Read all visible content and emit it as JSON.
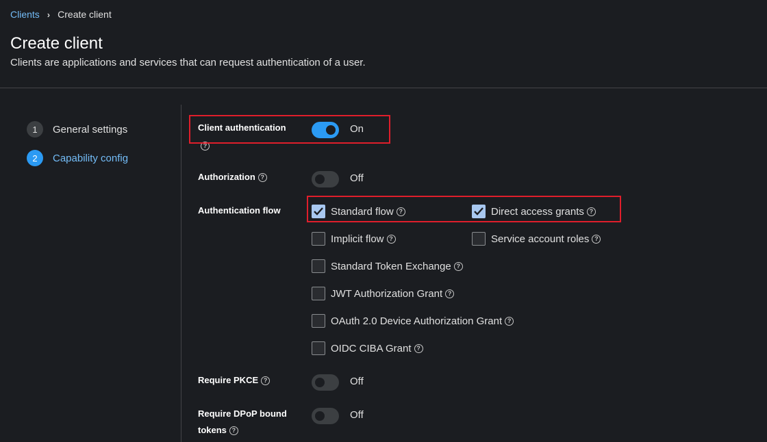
{
  "breadcrumb": {
    "parent": "Clients",
    "current": "Create client"
  },
  "header": {
    "title": "Create client",
    "description": "Clients are applications and services that can request authentication of a user."
  },
  "wizard": {
    "steps": [
      {
        "number": "1",
        "label": "General settings",
        "active": false
      },
      {
        "number": "2",
        "label": "Capability config",
        "active": true
      }
    ]
  },
  "form": {
    "client_authentication": {
      "label": "Client authentication",
      "state": "On"
    },
    "authorization": {
      "label": "Authorization",
      "state": "Off"
    },
    "authentication_flow": {
      "label": "Authentication flow",
      "options": [
        {
          "label": "Standard flow",
          "checked": true
        },
        {
          "label": "Direct access grants",
          "checked": true
        },
        {
          "label": "Implicit flow",
          "checked": false
        },
        {
          "label": "Service account roles",
          "checked": false
        },
        {
          "label": "Standard Token Exchange",
          "checked": false
        },
        {
          "label": "JWT Authorization Grant",
          "checked": false
        },
        {
          "label": "OAuth 2.0 Device Authorization Grant",
          "checked": false
        },
        {
          "label": "OIDC CIBA Grant",
          "checked": false
        }
      ]
    },
    "require_pkce": {
      "label": "Require PKCE",
      "state": "Off"
    },
    "require_dpop": {
      "label_line1": "Require DPoP bound",
      "label_line2": "tokens",
      "state": "Off"
    }
  },
  "colors": {
    "accent": "#2b9af3",
    "link": "#73bcf7",
    "highlight_box": "#e01e2b",
    "background": "#1b1d21"
  },
  "icons": {
    "help": "question-circle-icon",
    "breadcrumb_separator": "chevron-right-icon",
    "check": "check-icon"
  }
}
